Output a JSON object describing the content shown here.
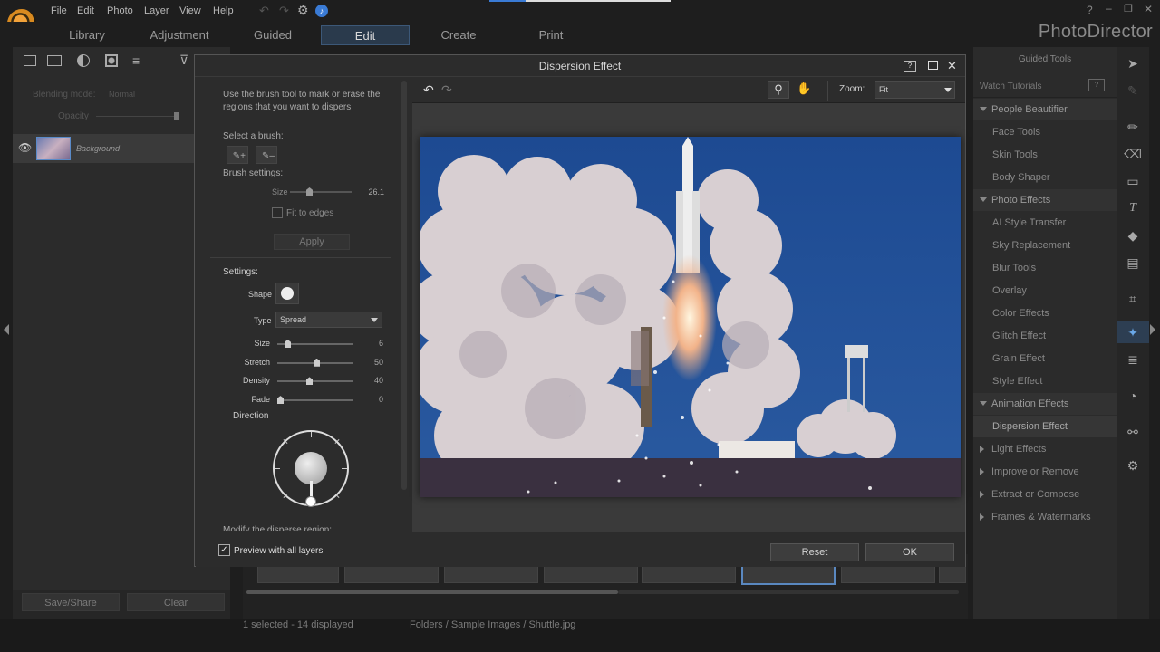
{
  "menu": {
    "items": [
      "File",
      "Edit",
      "Photo",
      "Layer",
      "View",
      "Help"
    ]
  },
  "tabs": [
    {
      "label": "Library"
    },
    {
      "label": "Adjustment"
    },
    {
      "label": "Guided"
    },
    {
      "label": "Edit"
    },
    {
      "label": "Create"
    },
    {
      "label": "Print"
    }
  ],
  "brand": "PhotoDirector",
  "left_panel": {
    "blending_label": "Blending mode:",
    "blending_value": "Normal",
    "opacity_label": "Opacity",
    "layer_name": "Background",
    "save_share": "Save/Share",
    "clear": "Clear"
  },
  "right_panel": {
    "title": "Guided Tools",
    "watch_tutorials": "Watch Tutorials",
    "sections": [
      {
        "label": "People Beautifier",
        "items": [
          "Face Tools",
          "Skin Tools",
          "Body Shaper"
        ]
      },
      {
        "label": "Photo Effects",
        "items": [
          "AI Style Transfer",
          "Sky Replacement",
          "Blur Tools",
          "Overlay",
          "Color Effects",
          "Glitch Effect",
          "Grain Effect",
          "Style Effect"
        ]
      },
      {
        "label": "Animation Effects",
        "items": [
          "Dispersion Effect"
        ]
      }
    ],
    "collapsed": [
      "Light Effects",
      "Improve or Remove",
      "Extract or Compose",
      "Frames & Watermarks"
    ]
  },
  "status": {
    "selection": "1 selected - 14 displayed",
    "path": "Folders / Sample Images / Shuttle.jpg"
  },
  "dialog": {
    "title": "Dispersion Effect",
    "instructions": "Use the brush tool to mark or erase the regions that you want to dispers",
    "select_brush": "Select a brush:",
    "brush_settings": "Brush settings:",
    "brush_size_label": "Size",
    "brush_size_value": "26.1",
    "fit_to_edges": "Fit to edges",
    "apply": "Apply",
    "settings": "Settings:",
    "shape_label": "Shape",
    "type_label": "Type",
    "type_value": "Spread",
    "sliders": [
      {
        "label": "Size",
        "value": "6",
        "fraction": 0.1
      },
      {
        "label": "Stretch",
        "value": "50",
        "fraction": 0.5
      },
      {
        "label": "Density",
        "value": "40",
        "fraction": 0.4
      },
      {
        "label": "Fade",
        "value": "0",
        "fraction": 0.0
      }
    ],
    "direction_label": "Direction",
    "modify_label": "Modify the disperse region:",
    "zoom_label": "Zoom:",
    "zoom_value": "Fit",
    "preview_all_layers": "Preview with all layers",
    "reset": "Reset",
    "ok": "OK"
  },
  "colors": {
    "accent": "#3c5878",
    "sky": "#1e4e96"
  }
}
